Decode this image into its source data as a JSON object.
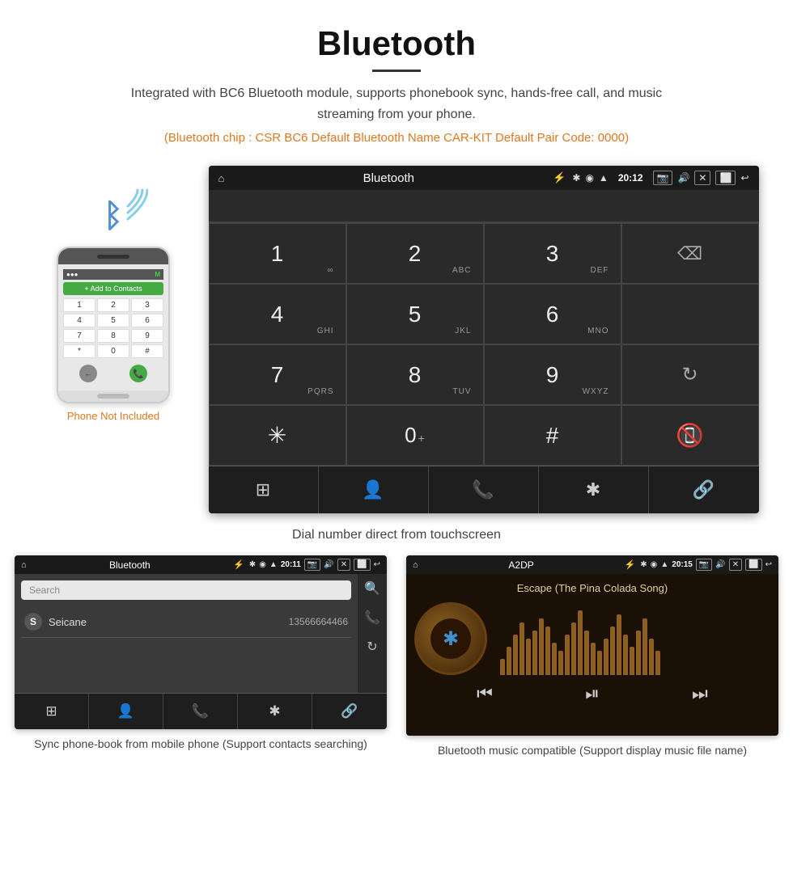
{
  "header": {
    "title": "Bluetooth",
    "description": "Integrated with BC6 Bluetooth module, supports phonebook sync, hands-free call, and music streaming from your phone.",
    "specs": "(Bluetooth chip : CSR BC6    Default Bluetooth Name CAR-KIT    Default Pair Code: 0000)"
  },
  "phone_side": {
    "not_included_label": "Phone Not Included",
    "add_contacts": "+ Add to Contacts",
    "keys": [
      "1",
      "2",
      "3",
      "4",
      "5",
      "6",
      "7",
      "8",
      "9",
      "*",
      "0",
      "#"
    ]
  },
  "car_screen": {
    "status_bar": {
      "title": "Bluetooth",
      "time": "20:12"
    },
    "dialpad": [
      {
        "main": "1",
        "sub": ""
      },
      {
        "main": "2",
        "sub": "ABC"
      },
      {
        "main": "3",
        "sub": "DEF"
      },
      {
        "main": "",
        "sub": ""
      },
      {
        "main": "4",
        "sub": "GHI"
      },
      {
        "main": "5",
        "sub": "JKL"
      },
      {
        "main": "6",
        "sub": "MNO"
      },
      {
        "main": "",
        "sub": ""
      },
      {
        "main": "7",
        "sub": "PQRS"
      },
      {
        "main": "8",
        "sub": "TUV"
      },
      {
        "main": "9",
        "sub": "WXYZ"
      },
      {
        "main": "reload",
        "sub": ""
      },
      {
        "main": "*",
        "sub": ""
      },
      {
        "main": "0+",
        "sub": ""
      },
      {
        "main": "#",
        "sub": ""
      },
      {
        "main": "call_end",
        "sub": ""
      }
    ],
    "bottom_nav": [
      "grid",
      "person",
      "phone",
      "bluetooth",
      "link"
    ]
  },
  "main_caption": "Dial number direct from touchscreen",
  "phonebook_screen": {
    "status_bar": {
      "title": "Bluetooth",
      "time": "20:11"
    },
    "search_placeholder": "Search",
    "contacts": [
      {
        "letter": "S",
        "name": "Seicane",
        "number": "13566664466"
      }
    ],
    "bottom_nav": [
      "grid",
      "person",
      "phone",
      "bluetooth",
      "link"
    ]
  },
  "music_screen": {
    "status_bar": {
      "title": "A2DP",
      "time": "20:15"
    },
    "song_title": "Escape (The Pina Colada Song)",
    "viz_heights": [
      20,
      35,
      50,
      65,
      45,
      55,
      70,
      60,
      40,
      30,
      50,
      65,
      80,
      55,
      40,
      30,
      45,
      60,
      75,
      50,
      35,
      55,
      70,
      45,
      30
    ],
    "controls": [
      "prev",
      "play_pause",
      "next"
    ]
  },
  "bottom_captions": {
    "phonebook": "Sync phone-book from mobile phone\n(Support contacts searching)",
    "music": "Bluetooth music compatible\n(Support display music file name)"
  }
}
